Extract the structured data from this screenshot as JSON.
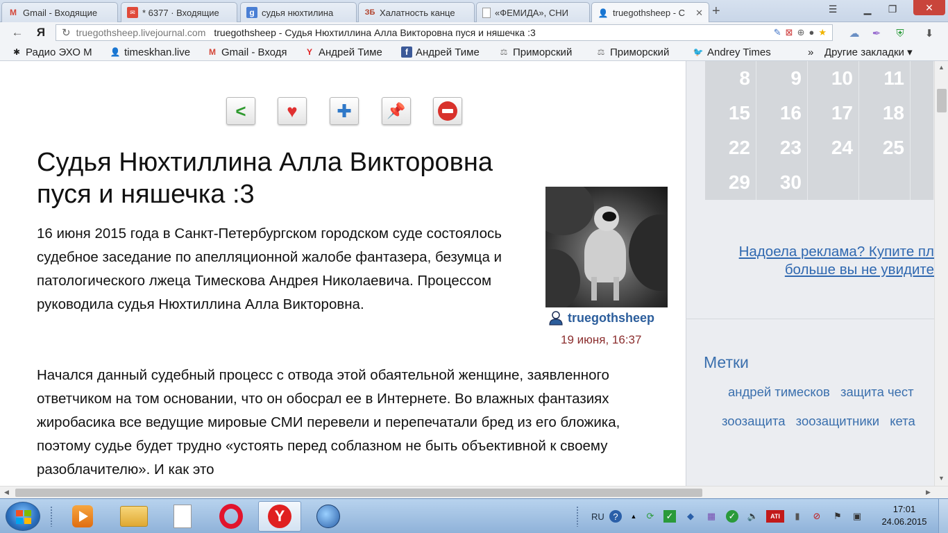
{
  "tabs": [
    {
      "label": "Gmail - Входящие",
      "icon": "gmail-icon",
      "active": false
    },
    {
      "label": "* 6377 · Входящие",
      "icon": "mail-icon",
      "active": false
    },
    {
      "label": "судья нюхтилина",
      "icon": "search-icon",
      "active": false
    },
    {
      "label": "Халатность канце",
      "icon": "zb-icon",
      "active": false
    },
    {
      "label": "«ФЕМИДА», СНИ",
      "icon": "page-icon",
      "active": false
    },
    {
      "label": "truegothsheep - С",
      "icon": "livejournal-user-icon",
      "active": true
    }
  ],
  "address": {
    "host": "truegothsheep.livejournal.com",
    "title": "truegothsheep - Судья Нюхтиллина Алла Викторовна пуся и няшечка :3"
  },
  "bookmarks": [
    {
      "label": "Радио ЭХО М",
      "icon": "radio-icon"
    },
    {
      "label": "timeskhan.live",
      "icon": "livejournal-user-icon"
    },
    {
      "label": "Gmail - Входя",
      "icon": "gmail-icon"
    },
    {
      "label": "Андрей Тиме",
      "icon": "yandex-icon"
    },
    {
      "label": "Андрей Тиме",
      "icon": "facebook-icon"
    },
    {
      "label": "Приморский",
      "icon": "scales-icon"
    },
    {
      "label": "Приморский",
      "icon": "scales-icon"
    },
    {
      "label": "Andrey Times",
      "icon": "twitter-icon"
    }
  ],
  "bookmarks_more": "»",
  "bookmarks_other": "Другие закладки ▾",
  "post": {
    "title": "Судья Нюхтиллина Алла Викторовна пуся и няшечка :3",
    "paragraph1": "16 июня 2015 года в Санкт-Петербургском городском суде состоялось судебное заседание по апелляционной жалобе фантазера, безумца и патологического лжеца Тимескова Андрея Николаевича. Процессом руководила судья Нюхтиллина Алла Викторовна.",
    "paragraph2": "Начался данный судебный процесс с отвода этой обаятельной женщине, заявленного ответчиком на том основании, что он обосрал ее в Интернете. Во влажных фантазиях жиробасика все ведущие мировые СМИ перевели и перепечатали бред из его бложика, поэтому судье будет трудно «устоять перед соблазном не быть объективной к своему разоблачителю». И как это",
    "author": "truegothsheep",
    "date": "19 июня, 16:37"
  },
  "calendar": [
    [
      "8",
      "9",
      "10",
      "11",
      ""
    ],
    [
      "15",
      "16",
      "17",
      "18",
      ""
    ],
    [
      "22",
      "23",
      "24",
      "25",
      ""
    ],
    [
      "29",
      "30",
      "",
      "",
      ""
    ]
  ],
  "promo": {
    "line1": "Надоела реклама? Купите пл",
    "line2": "больше вы не увидите"
  },
  "tags": {
    "heading": "Метки",
    "row1": [
      "андрей тимесков",
      "защита чест"
    ],
    "row2": [
      "зоозащита",
      "зоозащитники",
      "кета"
    ]
  },
  "taskbar": {
    "language": "RU",
    "time": "17:01",
    "date": "24.06.2015"
  },
  "colors": {
    "link": "#2c5e9c",
    "date": "#8b2e2e",
    "calendar_cell": "#d4d7db",
    "tags": "#3a6fad"
  }
}
